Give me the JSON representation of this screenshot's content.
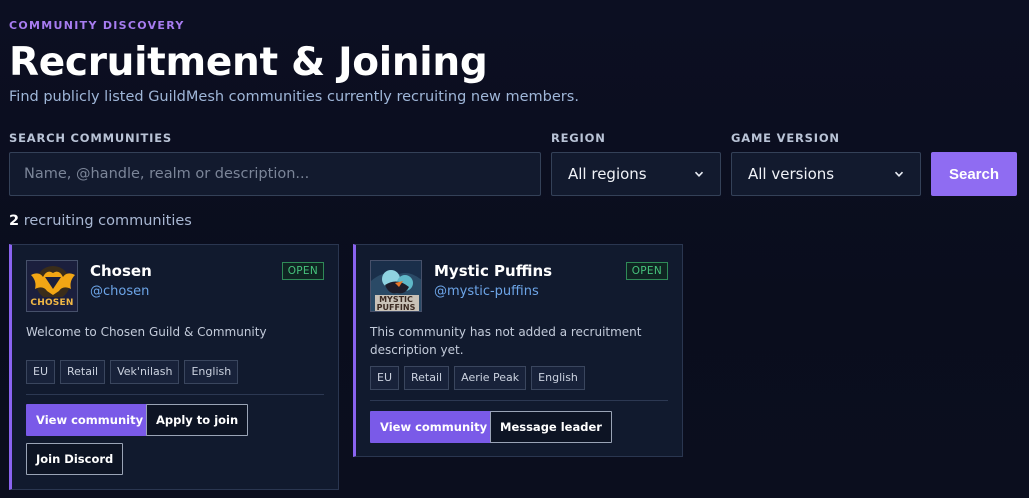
{
  "header": {
    "eyebrow": "COMMUNITY DISCOVERY",
    "title": "Recruitment & Joining",
    "subtitle": "Find publicly listed GuildMesh communities currently recruiting new members."
  },
  "filters": {
    "search_label": "SEARCH COMMUNITIES",
    "search_placeholder": "Name, @handle, realm or description...",
    "search_value": "",
    "region_label": "REGION",
    "region_value": "All regions",
    "version_label": "GAME VERSION",
    "version_value": "All versions",
    "search_button": "Search"
  },
  "results": {
    "count": "2",
    "count_text": " recruiting communities"
  },
  "communities": [
    {
      "name": "Chosen",
      "handle": "@chosen",
      "status": "OPEN",
      "avatar_text": "CHOSEN",
      "description": "Welcome to Chosen Guild & Community",
      "tags": [
        "EU",
        "Retail",
        "Vek'nilash",
        "English"
      ],
      "actions": [
        "View community",
        "Apply to join",
        "Join Discord"
      ]
    },
    {
      "name": "Mystic Puffins",
      "handle": "@mystic-puffins",
      "status": "OPEN",
      "avatar_text": "MYSTIC PUFFINS",
      "description": "This community has not added a recruitment description yet.",
      "tags": [
        "EU",
        "Retail",
        "Aerie Peak",
        "English"
      ],
      "actions": [
        "View community",
        "Message leader"
      ]
    }
  ],
  "colors": {
    "accent": "#8f6cf2",
    "open_badge": "#46c27c",
    "handle": "#6da5e8",
    "background": "#0c0f22"
  },
  "icons": {
    "chosen_avatar": "bat-emblem-icon",
    "puffins_avatar": "puffin-emblem-icon",
    "select_arrow": "chevron-down-icon"
  }
}
